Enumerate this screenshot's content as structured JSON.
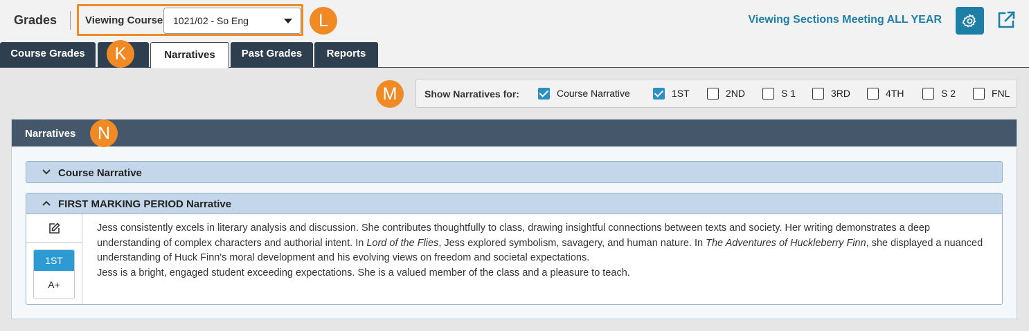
{
  "header": {
    "app_title": "Grades",
    "course_label": "Viewing Course",
    "course_value": "1021/02 - So Eng",
    "viewing_sections": "Viewing Sections Meeting ALL YEAR"
  },
  "badges": {
    "k": "K",
    "l": "L",
    "m": "M",
    "n": "N"
  },
  "tabs": [
    {
      "label": "Course Grades"
    },
    {
      "label": ""
    },
    {
      "label": "Narratives"
    },
    {
      "label": "Past Grades"
    },
    {
      "label": "Reports"
    }
  ],
  "filter": {
    "label": "Show Narratives for:",
    "options": [
      {
        "label": "Course Narrative",
        "checked": true
      },
      {
        "label": "1ST",
        "checked": true
      },
      {
        "label": "2ND",
        "checked": false
      },
      {
        "label": "S 1",
        "checked": false
      },
      {
        "label": "3RD",
        "checked": false
      },
      {
        "label": "4TH",
        "checked": false
      },
      {
        "label": "S 2",
        "checked": false
      },
      {
        "label": "FNL",
        "checked": false
      }
    ]
  },
  "panel": {
    "title": "Narratives",
    "course_narrative_title": "Course Narrative",
    "marking_period_title": "FIRST MARKING PERIOD Narrative",
    "grade_term": "1ST",
    "grade_value": "A+",
    "narrative": {
      "p1_a": "Jess consistently excels in literary analysis and discussion. She contributes thoughtfully to class, drawing insightful connections between texts and society. Her writing demonstrates a deep understanding of complex characters and authorial intent. In ",
      "title1": "Lord of the Flies",
      "p1_b": ", Jess explored symbolism, savagery, and human nature. In ",
      "title2": "The Adventures of Huckleberry Finn",
      "p1_c": ", she displayed a nuanced understanding of Huck Finn's moral development and his evolving views on freedom and societal expectations.",
      "p2": "Jess is a bright, engaged student exceeding expectations. She is a valued member of the class and a pleasure to teach."
    }
  },
  "colors": {
    "accent_orange": "#f08a24",
    "brand_blue": "#1e7fa6",
    "tab_dark": "#2e3f4f",
    "panel_header": "#44576b",
    "checkbox_blue": "#2c8fc4"
  }
}
